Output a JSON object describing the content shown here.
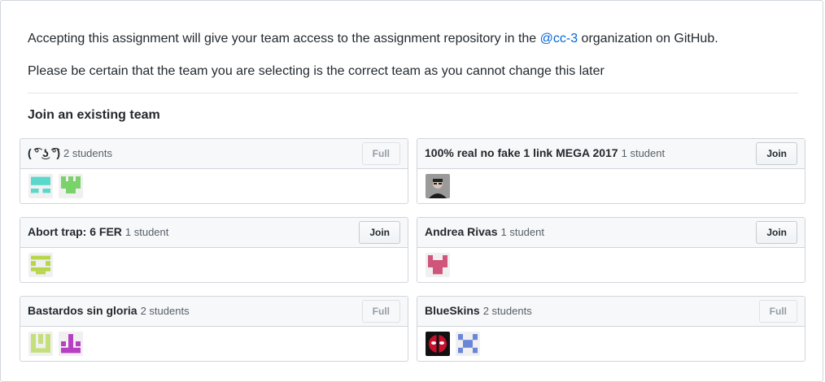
{
  "intro": {
    "line1_before": "Accepting this assignment will give your team access to the assignment repository in the ",
    "org_link": "@cc-3",
    "line1_after": " organization on GitHub.",
    "line2": "Please be certain that the team you are selecting is the correct team as you cannot change this later"
  },
  "section_title": "Join an existing team",
  "teams": [
    {
      "name": "( ͡° ͜ʖ ͡°)",
      "count": "2 students",
      "button": "Full",
      "full": true
    },
    {
      "name": "100% real no fake 1 link MEGA 2017",
      "count": "1 student",
      "button": "Join",
      "full": false
    },
    {
      "name": "Abort trap: 6 FER",
      "count": "1 student",
      "button": "Join",
      "full": false
    },
    {
      "name": "Andrea Rivas",
      "count": "1 student",
      "button": "Join",
      "full": false
    },
    {
      "name": "Bastardos sin gloria",
      "count": "2 students",
      "button": "Full",
      "full": true
    },
    {
      "name": "BlueSkins",
      "count": "2 students",
      "button": "Full",
      "full": true
    }
  ],
  "colors": {
    "identicon_teal": "#5ad8cc",
    "identicon_green": "#7ad26a",
    "identicon_olive": "#b8d64a",
    "identicon_pink": "#d0557a",
    "identicon_lime": "#c4e07a",
    "identicon_magenta": "#b83fc4",
    "identicon_blue": "#6a86d8",
    "link": "#0366d6"
  }
}
